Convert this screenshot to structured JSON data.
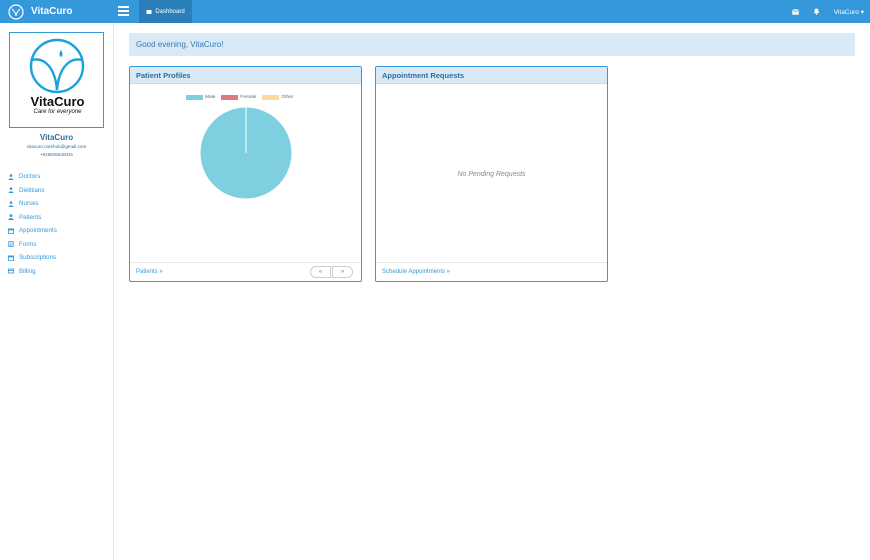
{
  "app": {
    "brand": "VitaCuro"
  },
  "topbar": {
    "dashboard_label": "Dashboard",
    "user_label": "VitaCuro"
  },
  "profile": {
    "logo_title": "VitaCuro",
    "logo_tagline": "Care for everyone",
    "name": "VitaCuro",
    "email": "vitacuro.carehub@gmail.com",
    "phone": "+919845540031"
  },
  "sidebar": {
    "items": [
      {
        "label": "Doctors",
        "icon": "user-md-icon"
      },
      {
        "label": "Dietitians",
        "icon": "user-md-icon"
      },
      {
        "label": "Nurses",
        "icon": "user-md-icon"
      },
      {
        "label": "Patients",
        "icon": "user-icon"
      },
      {
        "label": "Appointments",
        "icon": "calendar-icon"
      },
      {
        "label": "Forms",
        "icon": "form-icon"
      },
      {
        "label": "Subscriptions",
        "icon": "calendar-icon"
      },
      {
        "label": "Billing",
        "icon": "credit-card-icon"
      }
    ]
  },
  "greeting": "Good evening, VitaCuro!",
  "patient_profiles": {
    "title": "Patient Profiles",
    "footer_link": "Patients",
    "prev_label": "«",
    "next_label": "»"
  },
  "appointment_requests": {
    "title": "Appointment Requests",
    "empty_message": "No Pending Requests",
    "footer_link": "Schedule Appointments"
  },
  "chart_data": {
    "type": "pie",
    "categories": [
      "Male",
      "Female",
      "Other"
    ],
    "values": [
      100,
      0,
      0
    ],
    "colors": [
      "#7ecfe0",
      "#e07a7f",
      "#fddb96"
    ],
    "legend": "top"
  },
  "colors": {
    "primary": "#3498db",
    "panel_header": "#d9eaf6"
  }
}
